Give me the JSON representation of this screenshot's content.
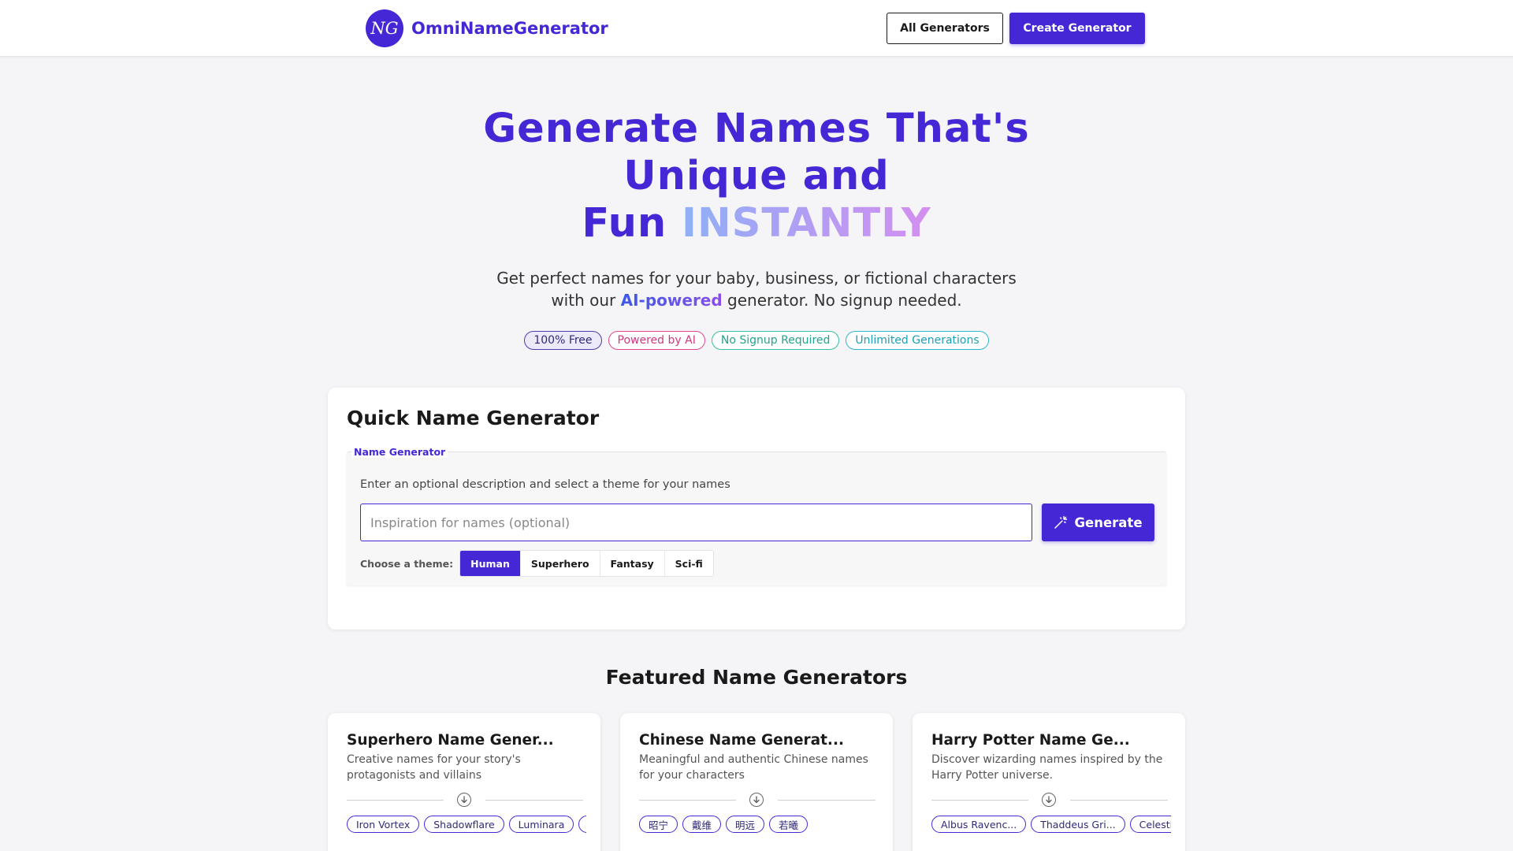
{
  "header": {
    "logo_initials": "NG",
    "brand": "OmniNameGenerator",
    "all_generators_label": "All Generators",
    "create_generator_label": "Create Generator"
  },
  "hero": {
    "title_line1": "Generate Names That's",
    "title_line2": "Unique and",
    "title_line3_prefix": "Fun",
    "title_line3_accent": "INSTANTLY",
    "subtitle_part1": "Get perfect names for your baby, business, or fictional characters",
    "subtitle_part2a": "with our",
    "subtitle_highlight": "AI-powered",
    "subtitle_part2b": "generator. No signup needed.",
    "badges": [
      "100% Free",
      "Powered by AI",
      "No Signup Required",
      "Unlimited Generations"
    ]
  },
  "quick_generator": {
    "title": "Quick Name Generator",
    "legend": "Name Generator",
    "description": "Enter an optional description and select a theme for your names",
    "input_placeholder": "Inspiration for names (optional)",
    "input_value": "",
    "generate_label": "Generate",
    "theme_label": "Choose a theme:",
    "themes": [
      "Human",
      "Superhero",
      "Fantasy",
      "Sci-fi"
    ],
    "selected_theme": "Human"
  },
  "featured": {
    "title": "Featured Name Generators",
    "cards": [
      {
        "title": "Superhero Name Gener...",
        "description": "Creative names for your story's protagonists and villains",
        "chips": [
          "Iron Vortex",
          "Shadowflare",
          "Luminara",
          "C"
        ]
      },
      {
        "title": "Chinese Name Generat...",
        "description": "Meaningful and authentic Chinese names for your characters",
        "chips": [
          "昭宁",
          "戴维",
          "明远",
          "若曦"
        ]
      },
      {
        "title": "Harry Potter Name Ge...",
        "description": "Discover wizarding names inspired by the Harry Potter universe.",
        "chips": [
          "Albus Ravenc...",
          "Thaddeus Gri...",
          "Celestia"
        ]
      }
    ]
  },
  "colors": {
    "brand": "#4527d6",
    "background": "#f5f5f7"
  },
  "icons": {
    "generate": "magic-wand-icon",
    "divider": "arrow-down-circle-icon"
  }
}
